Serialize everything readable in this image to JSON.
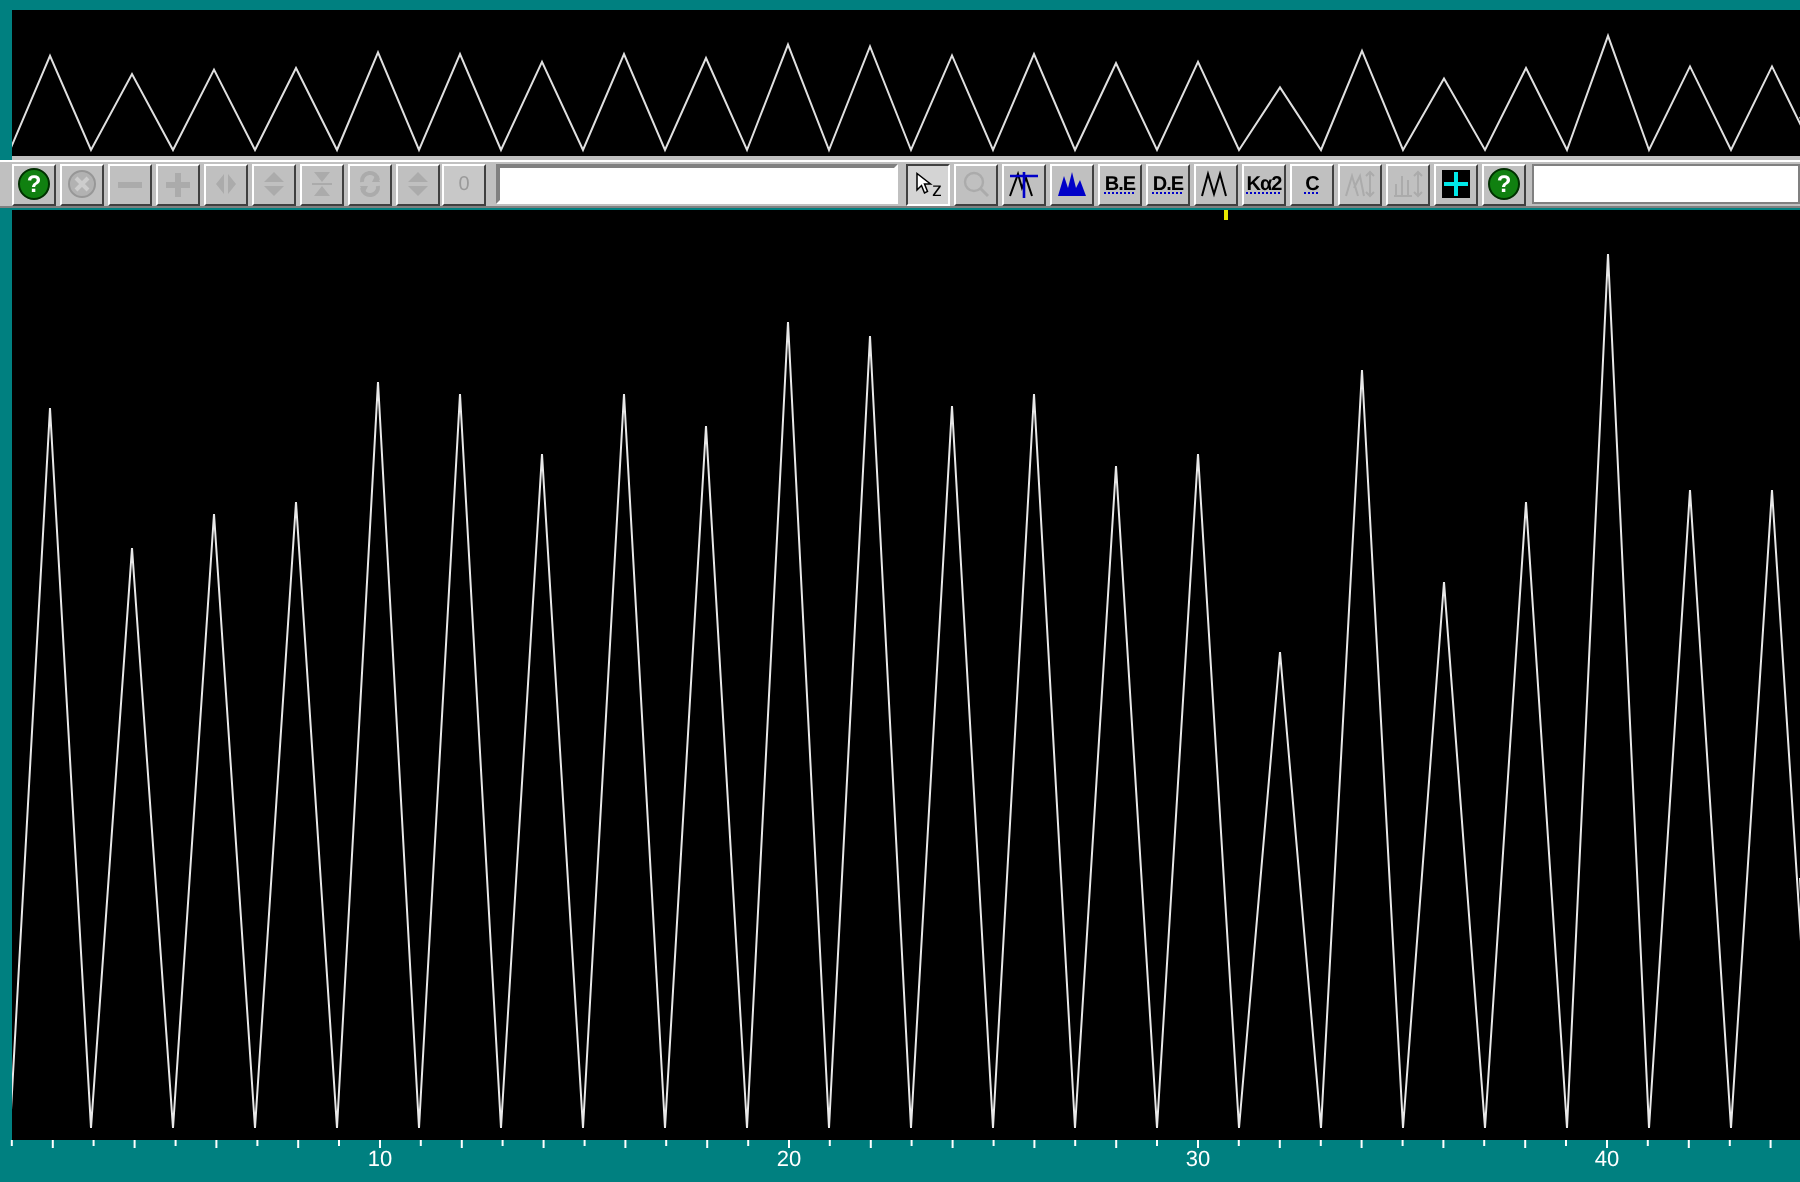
{
  "toolbar": {
    "left_buttons": [
      {
        "kind": "help",
        "symbol": "?",
        "disabled": false
      },
      {
        "kind": "stop",
        "disabled": true
      },
      {
        "kind": "minus",
        "disabled": true
      },
      {
        "kind": "plus",
        "disabled": true
      },
      {
        "kind": "expand-horizontal",
        "disabled": true
      },
      {
        "kind": "expand-vertical",
        "disabled": true
      },
      {
        "kind": "shrink-vertical",
        "disabled": true
      },
      {
        "kind": "refresh",
        "disabled": true
      },
      {
        "kind": "expand-vertical",
        "disabled": true
      }
    ],
    "value_field": {
      "value": "0",
      "disabled": true
    },
    "right_buttons": [
      {
        "kind": "pointer",
        "label": "z",
        "disabled": false,
        "pressed": true
      },
      {
        "kind": "zoom",
        "disabled": true,
        "pressed": false
      },
      {
        "kind": "peak-lines",
        "disabled": false,
        "pressed": false
      },
      {
        "kind": "filled-peaks",
        "disabled": false,
        "pressed": false
      },
      {
        "kind": "labeled",
        "label": "B.E",
        "disabled": false,
        "pressed": false
      },
      {
        "kind": "labeled",
        "label": "D.E",
        "disabled": false,
        "pressed": false
      },
      {
        "kind": "peaks",
        "disabled": false,
        "pressed": false
      },
      {
        "kind": "labeled",
        "label": "Kα2",
        "disabled": false,
        "pressed": false
      },
      {
        "kind": "labeled",
        "label": "C",
        "disabled": false,
        "pressed": false
      },
      {
        "kind": "peak-scale",
        "disabled": true,
        "pressed": false
      },
      {
        "kind": "bar-scale",
        "disabled": true,
        "pressed": false
      },
      {
        "kind": "grid",
        "disabled": false,
        "pressed": false
      },
      {
        "kind": "help",
        "symbol": "?",
        "disabled": false,
        "pressed": false
      }
    ]
  },
  "x_axis": {
    "labels": [
      "10",
      "20",
      "30",
      "40"
    ]
  }
}
